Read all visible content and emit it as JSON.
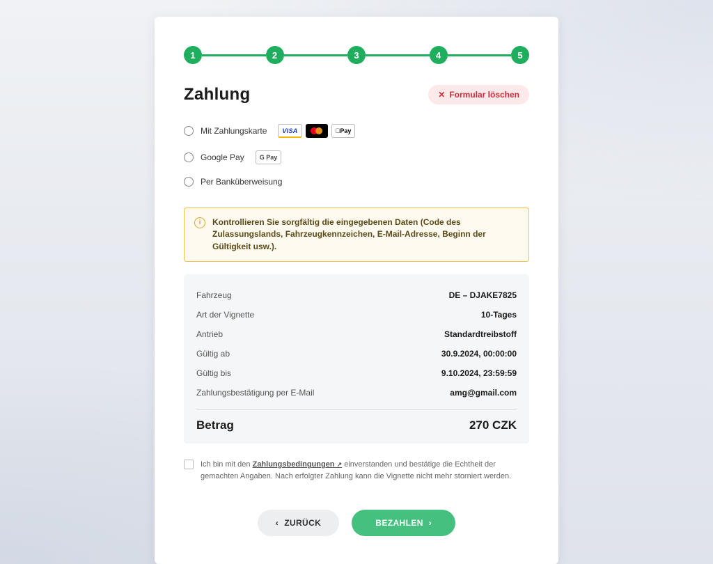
{
  "stepper": {
    "steps": [
      "1",
      "2",
      "3",
      "4",
      "5"
    ],
    "current": 5
  },
  "header": {
    "title": "Zahlung",
    "clear_label": "Formular löschen"
  },
  "payment_options": {
    "card": {
      "label": "Mit Zahlungskarte",
      "icons": [
        "visa-icon",
        "mastercard-icon",
        "applepay-icon"
      ]
    },
    "gpay": {
      "label": "Google Pay",
      "icons": [
        "gpay-icon"
      ]
    },
    "bank": {
      "label": "Per Banküberweisung"
    }
  },
  "icon_text": {
    "visa": "VISA",
    "applepay": "Pay",
    "gpay": "G Pay"
  },
  "info_box": {
    "text": "Kontrollieren Sie sorgfältig die eingegebenen Daten (Code des Zulassungslands, Fahrzeugkennzeichen, E-Mail-Adresse, Beginn der Gültigkeit usw.)."
  },
  "summary": {
    "rows": [
      {
        "k": "Fahrzeug",
        "v": "DE – DJAKE7825"
      },
      {
        "k": "Art der Vignette",
        "v": "10-Tages"
      },
      {
        "k": "Antrieb",
        "v": "Standardtreibstoff"
      },
      {
        "k": "Gültig ab",
        "v": "30.9.2024, 00:00:00"
      },
      {
        "k": "Gültig bis",
        "v": "9.10.2024, 23:59:59"
      },
      {
        "k": "Zahlungsbestätigung per E-Mail",
        "v": "amg@gmail.com"
      }
    ],
    "total_label": "Betrag",
    "total_value": "270 CZK"
  },
  "terms": {
    "pre": "Ich bin mit den ",
    "link": "Zahlungsbedingungen",
    "post": " einverstanden und bestätige die Echtheit der gemachten Angaben. Nach erfolgter Zahlung kann die Vignette nicht mehr storniert werden."
  },
  "footer": {
    "back": "ZURÜCK",
    "pay": "BEZAHLEN"
  }
}
